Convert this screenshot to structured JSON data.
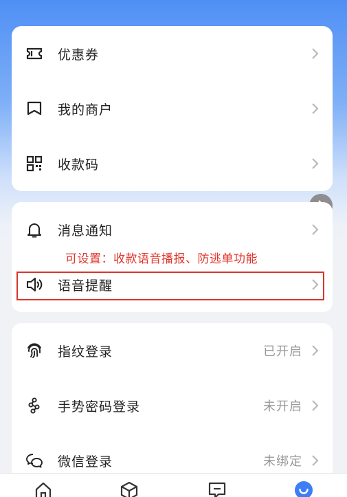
{
  "card1": {
    "items": [
      {
        "label": "优惠券",
        "icon": "ticket-icon"
      },
      {
        "label": "我的商户",
        "icon": "shop-icon"
      },
      {
        "label": "收款码",
        "icon": "qr-code-icon"
      }
    ]
  },
  "card2": {
    "items": [
      {
        "label": "消息通知",
        "icon": "bell-icon"
      },
      {
        "label": "语音提醒",
        "icon": "speaker-icon"
      }
    ],
    "annotation": "可设置：收款语音播报、防逃单功能"
  },
  "card3": {
    "items": [
      {
        "label": "指纹登录",
        "value": "已开启",
        "icon": "fingerprint-icon"
      },
      {
        "label": "手势密码登录",
        "value": "未开启",
        "icon": "gesture-icon"
      },
      {
        "label": "微信登录",
        "value": "未绑定",
        "icon": "wechat-icon"
      }
    ]
  },
  "tabbar": {
    "tabs": [
      {
        "icon": "home-icon"
      },
      {
        "icon": "box-icon"
      },
      {
        "icon": "message-icon"
      },
      {
        "icon": "profile-icon",
        "active": true
      }
    ]
  },
  "colors": {
    "accent": "#3d7ef5",
    "annotation": "#e0352b",
    "muted": "#999999"
  }
}
